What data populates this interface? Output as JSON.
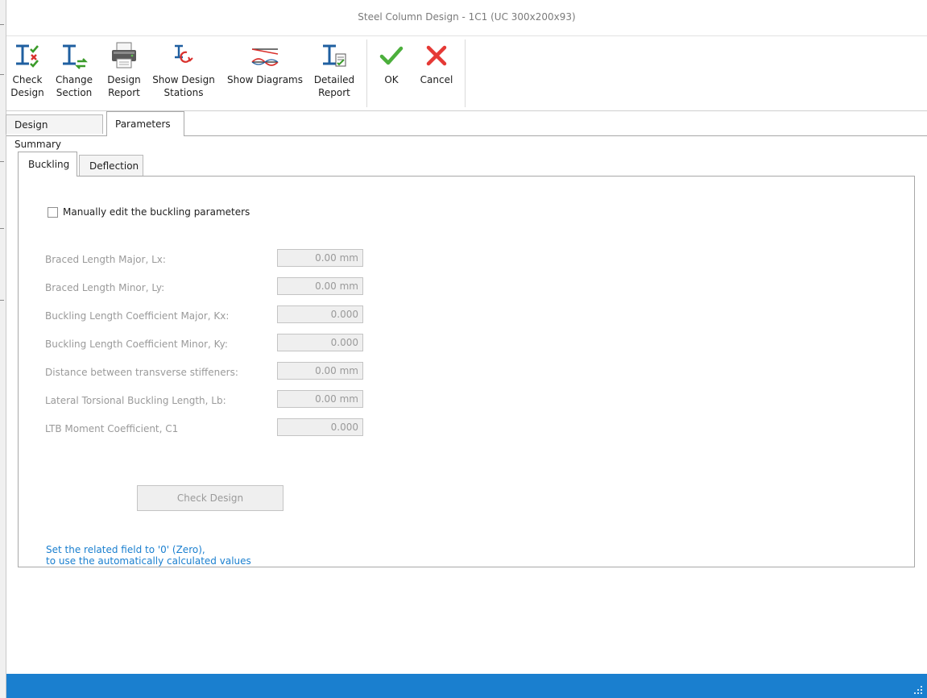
{
  "window": {
    "title": "Steel Column Design - 1C1 (UC 300x200x93)"
  },
  "toolbar": {
    "check_design": "Check\nDesign",
    "change_section": "Change\nSection",
    "design_report": "Design\nReport",
    "show_design_stations": "Show Design\nStations",
    "show_diagrams": "Show Diagrams",
    "detailed_report": "Detailed\nReport",
    "ok": "OK",
    "cancel": "Cancel"
  },
  "tabs": [
    {
      "label": "Design Summary",
      "active": false
    },
    {
      "label": "Parameters",
      "active": true
    }
  ],
  "subtabs": [
    {
      "label": "Buckling",
      "active": true
    },
    {
      "label": "Deflection",
      "active": false
    }
  ],
  "buckling": {
    "manual_edit_label": "Manually edit the buckling parameters",
    "manual_edit_checked": false,
    "fields": [
      {
        "label": "Braced Length Major, Lx:",
        "value": "0.00 mm"
      },
      {
        "label": "Braced Length Minor, Ly:",
        "value": "0.00 mm"
      },
      {
        "label": "Buckling Length Coefficient Major, Kx:",
        "value": "0.000"
      },
      {
        "label": "Buckling Length Coefficient Minor, Ky:",
        "value": "0.000"
      },
      {
        "label": "Distance between transverse stiffeners:",
        "value": "0.00 mm"
      },
      {
        "label": "Lateral Torsional Buckling Length, Lb:",
        "value": "0.00 mm"
      },
      {
        "label": "LTB Moment Coefficient, C1",
        "value": "0.000"
      }
    ],
    "check_design_button": "Check Design",
    "hint_line1": "Set the related field to '0' (Zero),",
    "hint_line2": "to use the automatically calculated values"
  },
  "colors": {
    "accent": "#1a7fcf",
    "ok_green": "#4caf3c",
    "cancel_red": "#e53935",
    "disabled_text": "#9a9a9a"
  },
  "icons": {
    "check_design": "beam-check-icon",
    "change_section": "beam-swap-icon",
    "design_report": "printer-icon",
    "show_design_stations": "beam-stations-icon",
    "show_diagrams": "diagram-icon",
    "detailed_report": "beam-report-icon",
    "ok": "checkmark-icon",
    "cancel": "cross-icon"
  }
}
